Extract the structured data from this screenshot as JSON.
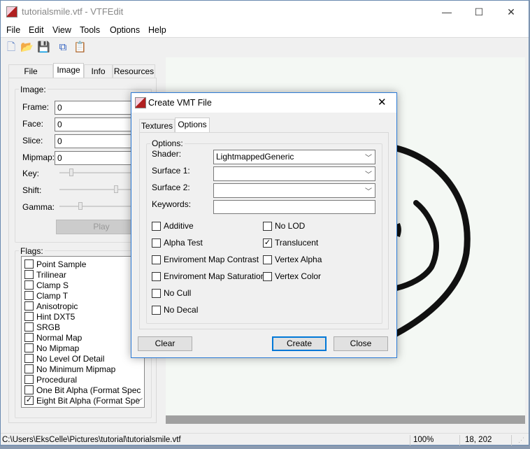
{
  "window": {
    "title": "tutorialsmile.vtf - VTFEdit",
    "minimize": "—",
    "maximize": "☐",
    "close": "✕"
  },
  "menu": [
    "File",
    "Edit",
    "View",
    "Tools",
    "Options",
    "Help"
  ],
  "toolbar": [
    {
      "icon": "new-file-icon",
      "glyph": "🗋"
    },
    {
      "icon": "open-folder-icon",
      "glyph": "📂"
    },
    {
      "icon": "save-icon",
      "glyph": "💾"
    },
    {
      "icon": "copy-icon",
      "glyph": "⧉"
    },
    {
      "icon": "paste-icon",
      "glyph": "📋"
    }
  ],
  "left_tabs": [
    "File System",
    "Image",
    "Info",
    "Resources"
  ],
  "image_group": {
    "title": "Image:",
    "frame_label": "Frame:",
    "frame": "0",
    "face_label": "Face:",
    "face": "0",
    "slice_label": "Slice:",
    "slice": "0",
    "mipmap_label": "Mipmap:",
    "mipmap": "0",
    "key_label": "Key:",
    "shift_label": "Shift:",
    "gamma_label": "Gamma:",
    "play": "Play"
  },
  "flags": {
    "title": "Flags:",
    "items": [
      {
        "label": "Point Sample",
        "checked": false
      },
      {
        "label": "Trilinear",
        "checked": false
      },
      {
        "label": "Clamp S",
        "checked": false
      },
      {
        "label": "Clamp T",
        "checked": false
      },
      {
        "label": "Anisotropic",
        "checked": false
      },
      {
        "label": "Hint DXT5",
        "checked": false
      },
      {
        "label": "SRGB",
        "checked": false
      },
      {
        "label": "Normal Map",
        "checked": false
      },
      {
        "label": "No Mipmap",
        "checked": false
      },
      {
        "label": "No Level Of Detail",
        "checked": false
      },
      {
        "label": "No Minimum Mipmap",
        "checked": false
      },
      {
        "label": "Procedural",
        "checked": false
      },
      {
        "label": "One Bit Alpha (Format Spec",
        "checked": false
      },
      {
        "label": "Eight Bit Alpha (Format Spe",
        "checked": true
      }
    ]
  },
  "dialog": {
    "title": "Create VMT File",
    "close": "✕",
    "tabs": [
      "Textures",
      "Options"
    ],
    "group_title": "Options:",
    "shader_label": "Shader:",
    "shader": "LightmappedGeneric",
    "surface1_label": "Surface 1:",
    "surface1": "",
    "surface2_label": "Surface 2:",
    "surface2": "",
    "keywords_label": "Keywords:",
    "keywords": "",
    "left_options": [
      {
        "label": "Additive",
        "checked": false
      },
      {
        "label": "Alpha Test",
        "checked": false
      },
      {
        "label": "Enviroment Map Contrast",
        "checked": false
      },
      {
        "label": "Enviroment Map Saturation",
        "checked": false
      },
      {
        "label": "No Cull",
        "checked": false
      },
      {
        "label": "No Decal",
        "checked": false
      }
    ],
    "right_options": [
      {
        "label": "No LOD",
        "checked": false
      },
      {
        "label": "Translucent",
        "checked": true
      },
      {
        "label": "Vertex Alpha",
        "checked": false
      },
      {
        "label": "Vertex Color",
        "checked": false
      }
    ],
    "clear": "Clear",
    "create": "Create",
    "close_button": "Close"
  },
  "status": {
    "path": "C:\\Users\\EksCelle\\Pictures\\tutorial\\tutorialsmile.vtf",
    "zoom": "100%",
    "coords": "18, 202"
  }
}
